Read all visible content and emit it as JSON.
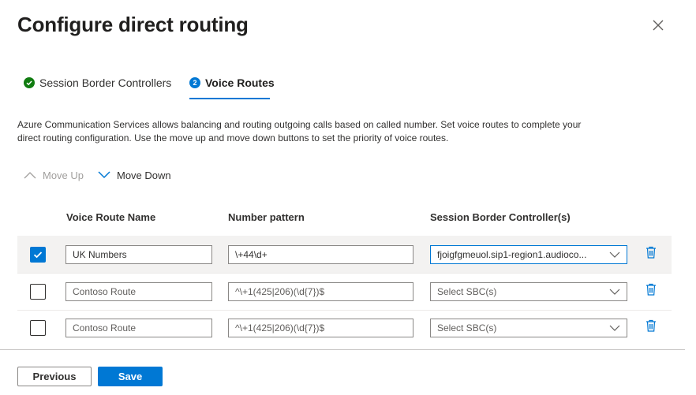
{
  "dialog": {
    "title": "Configure direct routing"
  },
  "steps": [
    {
      "label": "Session Border Controllers",
      "state": "completed"
    },
    {
      "label": "Voice Routes",
      "number": "2",
      "state": "active"
    }
  ],
  "description": "Azure Communication Services allows balancing and routing outgoing calls based on called number. Set voice routes to complete your direct routing configuration. Use the move up and move down buttons to set the priority of voice routes.",
  "toolbar": {
    "move_up": "Move Up",
    "move_down": "Move Down"
  },
  "table": {
    "headers": [
      "Voice Route Name",
      "Number pattern",
      "Session Border Controller(s)"
    ],
    "rows": [
      {
        "checked": true,
        "name": "UK Numbers",
        "pattern": "\\+44\\d+",
        "sbc": "fjoigfgmeuol.sip1-region1.audioco..."
      },
      {
        "checked": false,
        "name": "Contoso Route",
        "pattern": "^\\+1(425|206)(\\d{7})$",
        "sbc": "Select SBC(s)"
      },
      {
        "checked": false,
        "name": "Contoso Route",
        "pattern": "^\\+1(425|206)(\\d{7})$",
        "sbc": "Select SBC(s)"
      }
    ]
  },
  "footer": {
    "previous": "Previous",
    "save": "Save"
  },
  "icons": {
    "close": "close-icon",
    "step_done": "checkmark-circle-icon",
    "move_up": "chevron-up-icon",
    "move_down": "chevron-down-icon",
    "delete": "trash-icon"
  },
  "colors": {
    "accent": "#0078d4",
    "success": "#107c10",
    "selected_row": "#f3f2f1"
  }
}
